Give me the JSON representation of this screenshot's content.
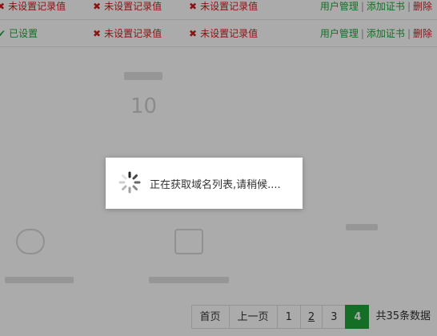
{
  "rows": [
    {
      "status": {
        "mark": "✖",
        "text": "未设置记录值",
        "tone": "bad"
      },
      "record2": {
        "mark": "✖",
        "text": "未设置记录值"
      },
      "record3": {
        "mark": "✖",
        "text": "未设置记录值"
      },
      "ops": [
        "用户管理",
        "添加证书",
        "删除"
      ]
    },
    {
      "status": {
        "mark": "✔",
        "text": "已设置",
        "tone": "good"
      },
      "record2": {
        "mark": "✖",
        "text": "未设置记录值"
      },
      "record3": {
        "mark": "✖",
        "text": "未设置记录值"
      },
      "ops": [
        "用户管理",
        "添加证书",
        "删除"
      ]
    }
  ],
  "ops_separator": "|",
  "background_stat": {
    "value": "10"
  },
  "pagination": {
    "first": "首页",
    "prev": "上一页",
    "pages": [
      "1",
      "2",
      "3",
      "4"
    ],
    "current": "4",
    "total": "共35条数据"
  },
  "loading": {
    "text": "正在获取域名列表,请稍候...."
  },
  "colors": {
    "accent": "#20a53a",
    "danger": "#cc1f1f",
    "overlay": "rgba(0,0,0,0.33)"
  }
}
